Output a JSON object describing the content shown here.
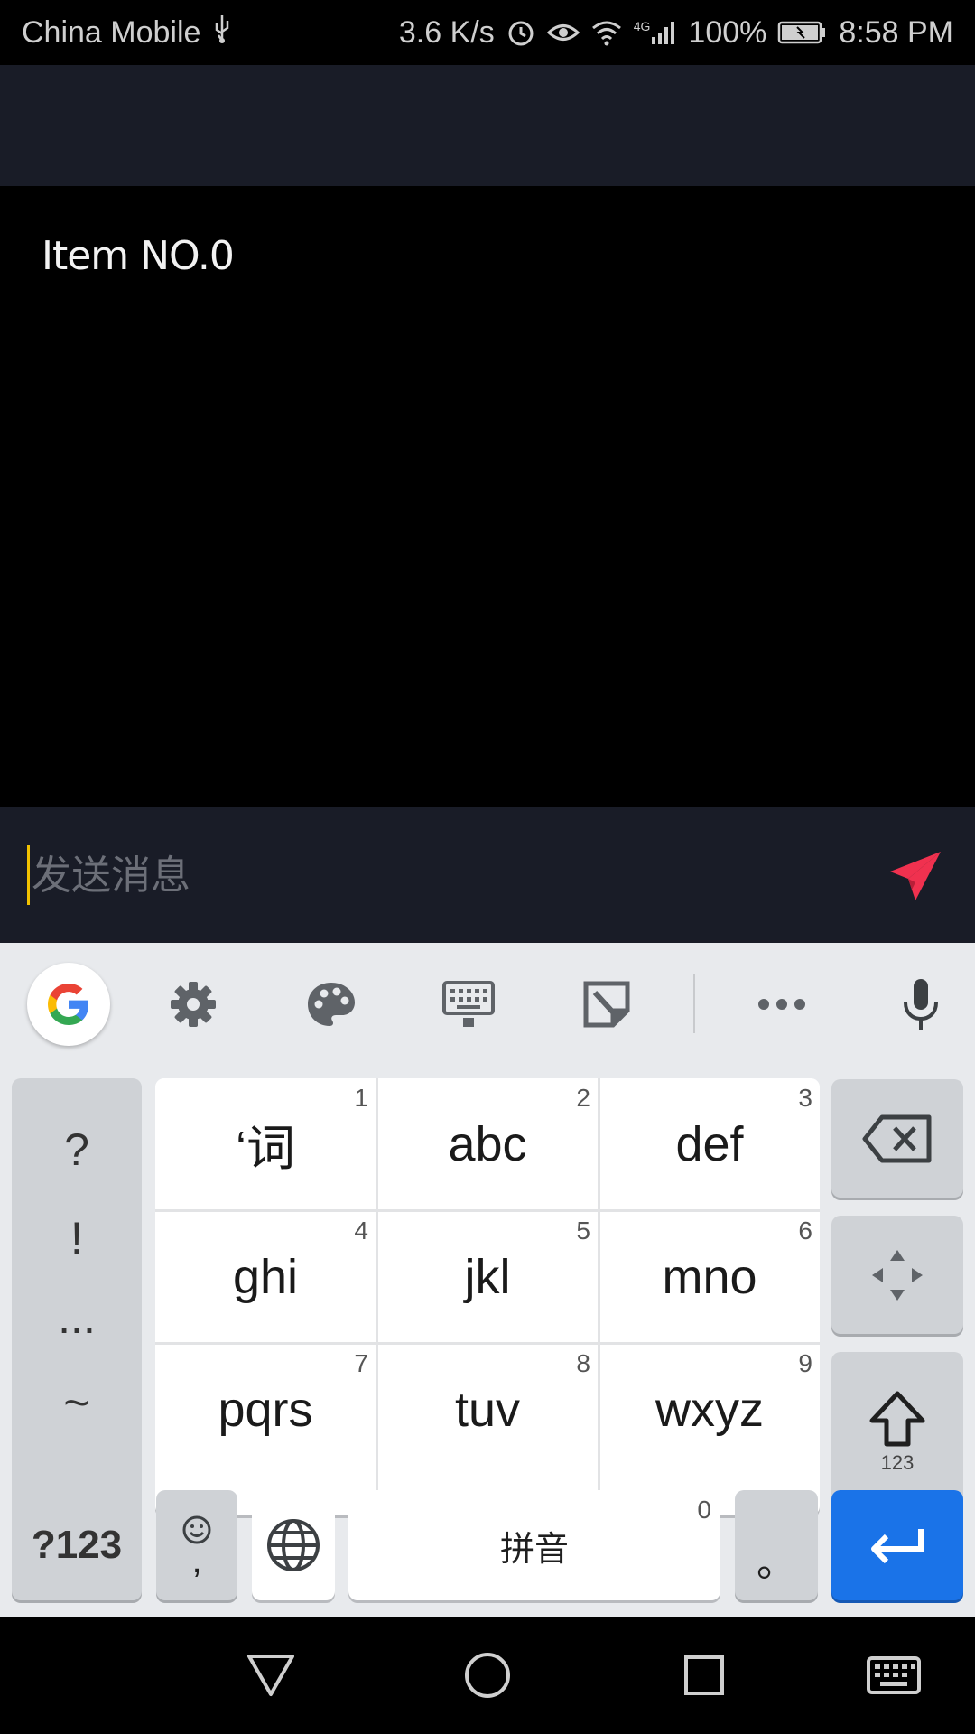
{
  "status_bar": {
    "carrier": "China Mobile",
    "speed": "3.6 K/s",
    "network_type": "4G",
    "battery": "100%",
    "time": "8:58 PM"
  },
  "list": {
    "items": [
      {
        "label": "Item NO.0"
      }
    ]
  },
  "composer": {
    "placeholder": "发送消息",
    "send_icon": "send-icon",
    "send_color": "#f0314f"
  },
  "keyboard": {
    "toolbar_icons": [
      "google-icon",
      "gear-icon",
      "palette-icon",
      "keyboard-icon",
      "sticker-icon",
      "more-icon",
      "microphone-icon"
    ],
    "symbols": [
      "?",
      "!",
      "...",
      "~"
    ],
    "t9_keys": [
      {
        "label": "‘词",
        "num": "1"
      },
      {
        "label": "abc",
        "num": "2"
      },
      {
        "label": "def",
        "num": "3"
      },
      {
        "label": "ghi",
        "num": "4"
      },
      {
        "label": "jkl",
        "num": "5"
      },
      {
        "label": "mno",
        "num": "6"
      },
      {
        "label": "pqrs",
        "num": "7"
      },
      {
        "label": "tuv",
        "num": "8"
      },
      {
        "label": "wxyz",
        "num": "9"
      }
    ],
    "shift_sublabel": "123",
    "mode_label": "?123",
    "emoji_comma": ",",
    "space_label": "拼音",
    "space_num": "0",
    "period_label": "。",
    "accent_color": "#1a73e8"
  },
  "nav_bar": {
    "icons": [
      "back-icon",
      "home-icon",
      "recents-icon",
      "keyboard-switch-icon"
    ]
  }
}
